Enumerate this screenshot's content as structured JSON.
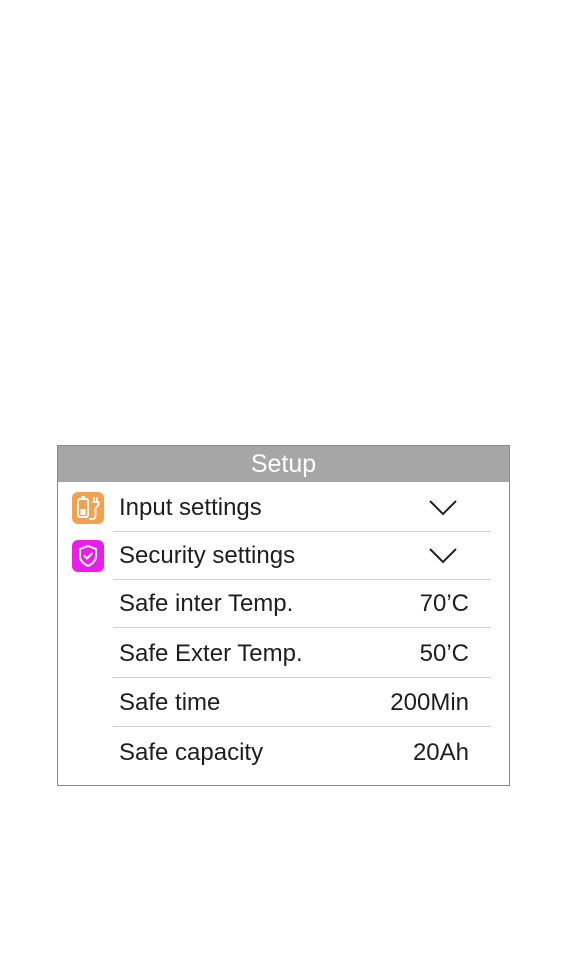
{
  "header": {
    "title": "Setup"
  },
  "icons": {
    "input": {
      "name": "battery-charger-icon",
      "color": "#f5a04e"
    },
    "security": {
      "name": "shield-check-icon",
      "color": "#e81fe8"
    }
  },
  "rows": [
    {
      "label": "Input settings",
      "type": "dropdown"
    },
    {
      "label": "Security settings",
      "type": "dropdown"
    },
    {
      "label": "Safe inter Temp.",
      "value": "70’C"
    },
    {
      "label": "Safe Exter Temp.",
      "value": "50’C"
    },
    {
      "label": "Safe time",
      "value": "200Min"
    },
    {
      "label": "Safe capacity",
      "value": "20Ah"
    }
  ]
}
